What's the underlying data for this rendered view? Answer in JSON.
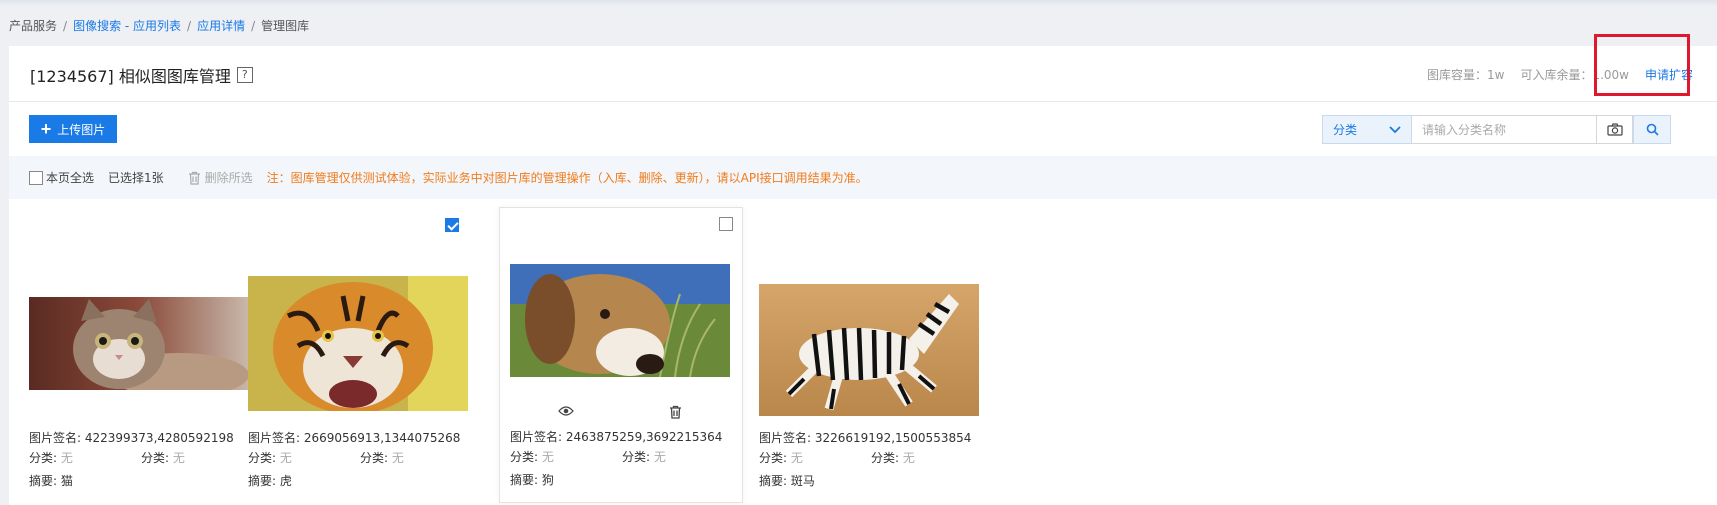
{
  "breadcrumb": {
    "items": [
      "产品服务",
      "图像搜索 - 应用列表",
      "应用详情",
      "管理图库"
    ],
    "sep": "/"
  },
  "header": {
    "title": "[1234567] 相似图图库管理",
    "help": "?",
    "capacity": "图库容量：1w",
    "remaining": "可入库余量：1.00w",
    "apply": "申请扩容"
  },
  "toolbar": {
    "upload_label": "上传图片",
    "category_select": "分类",
    "search_placeholder": "请输入分类名称"
  },
  "selectbar": {
    "select_all": "本页全选",
    "selected": "已选择1张",
    "delete_selected": "删除所选",
    "note": "注：图库管理仅供测试体验，实际业务中对图片库的管理操作（入库、删除、更新），请以API接口调用结果为准。"
  },
  "cards": [
    {
      "signature": "图片签名: 422399373,4280592198",
      "cat_label": "分类:",
      "cat_value": "无",
      "abstract_label": "摘要:",
      "abstract": "猫",
      "checked": false,
      "image": "cat"
    },
    {
      "signature": "图片签名: 2669056913,1344075268",
      "cat_label": "分类:",
      "cat_value": "无",
      "abstract_label": "摘要:",
      "abstract": "虎",
      "checked": true,
      "image": "tiger"
    },
    {
      "signature": "图片签名: 2463875259,3692215364",
      "cat_label": "分类:",
      "cat_value": "无",
      "abstract_label": "摘要:",
      "abstract": "狗",
      "checked": false,
      "image": "dog"
    },
    {
      "signature": "图片签名: 3226619192,1500553854",
      "cat_label": "分类:",
      "cat_value": "无",
      "abstract_label": "摘要:",
      "abstract": "斑马",
      "checked": false,
      "image": "zebra"
    }
  ],
  "colors": {
    "accent": "#1a7ae6",
    "warning": "#f27b1a",
    "highlight": "#e0182d"
  },
  "icons": [
    "plus-icon",
    "chevron-down-icon",
    "camera-icon",
    "search-icon",
    "trash-icon",
    "eye-icon"
  ]
}
